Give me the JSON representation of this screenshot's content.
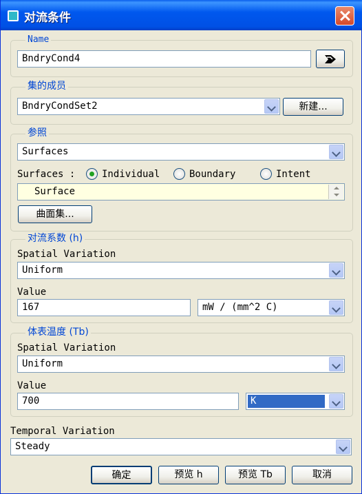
{
  "window": {
    "title": "对流条件"
  },
  "name_group": {
    "legend": "Name",
    "value": "BndryCond4"
  },
  "set_group": {
    "legend": "集的成员",
    "value": "BndryCondSet2",
    "new_button": "新建..."
  },
  "ref_group": {
    "legend": "参照",
    "type_value": "Surfaces",
    "surfaces_label": "Surfaces :",
    "radio_options": [
      {
        "label": "Individual",
        "checked": true
      },
      {
        "label": "Boundary",
        "checked": false
      },
      {
        "label": "Intent",
        "checked": false
      }
    ],
    "list_item": "Surface",
    "surface_set_button": "曲面集..."
  },
  "coeff_group": {
    "legend": "对流系数 (h)",
    "spatial_label": "Spatial Variation",
    "spatial_value": "Uniform",
    "value_label": "Value",
    "value": "167",
    "unit": "mW / (mm^2 C)"
  },
  "temp_group": {
    "legend": "体表温度 (Tb)",
    "spatial_label": "Spatial Variation",
    "spatial_value": "Uniform",
    "value_label": "Value",
    "value": "700",
    "unit": "K"
  },
  "temporal": {
    "label": "Temporal Variation",
    "value": "Steady"
  },
  "buttons": {
    "ok": "确定",
    "preview_h": "预览 h",
    "preview_tb": "预览 Tb",
    "cancel": "取消"
  },
  "colors": {
    "titlebar": "#0058EE",
    "legend_text": "#0046D5",
    "dialog_bg": "#ECE9D8",
    "selection": "#316AC5"
  }
}
